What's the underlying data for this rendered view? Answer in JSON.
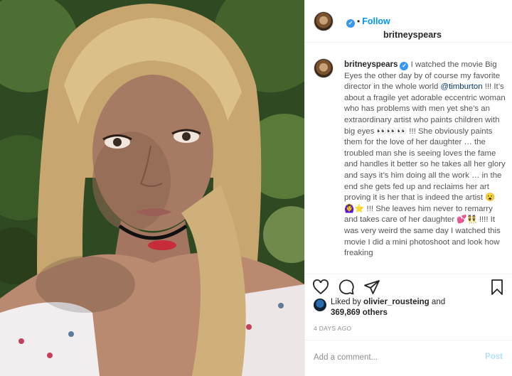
{
  "post": {
    "username": "britneyspears",
    "follow_label": "Follow",
    "dot": "•"
  },
  "caption": {
    "username": "britneyspears",
    "text_before_mention": "I watched the movie Big Eyes the other day by of course my favorite director in the whole world",
    "mention": "@timburton",
    "text_after_mention": "!!! It’s about a fragile yet adorable eccentric woman who has problems with men yet she’s an extraordinary artist who paints children with big eyes 👀👀👀 !!!  She obviously paints them for the love of her daughter … the troubled man she is seeing loves the fame and handles it better so he takes all her glory and says it’s him doing all the work … in the end she gets fed up and reclaims her art proving it is her that is indeed the artist 😮🙆‍♀️⭐️ !!! She leaves him never to remarry and takes care of her daughter 💕👯 !!!! It was very weird the same day I watched this movie I did a mini photoshoot and look how freaking"
  },
  "actions": {
    "like_icon": "heart-icon",
    "comment_icon": "comment-icon",
    "share_icon": "paper-plane-icon",
    "save_icon": "bookmark-icon"
  },
  "likes": {
    "liked_by_prefix": "Liked by",
    "liked_by_user": "olivier_rousteing",
    "and": "and",
    "others_count": "369,869 others"
  },
  "timestamp": "4 DAYS AGO",
  "comment": {
    "placeholder": "Add a comment...",
    "post_label": "Post"
  },
  "colors": {
    "link_blue": "#0095f6",
    "verified_blue": "#3897f0",
    "post_disabled": "#b2dffc",
    "muted_text": "#8e8e8e"
  }
}
